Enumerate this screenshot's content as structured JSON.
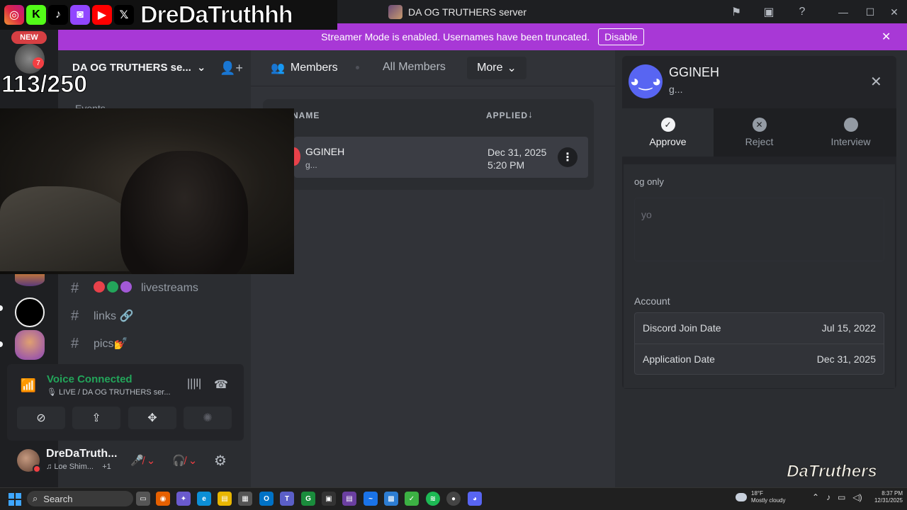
{
  "window": {
    "title": "DA OG TRUTHERS server"
  },
  "titlebar_icons": [
    "flag-icon",
    "inbox-icon",
    "help-icon"
  ],
  "banner": {
    "text": "Streamer Mode is enabled. Usernames have been truncated.",
    "button_label": "Disable"
  },
  "overlay": {
    "handle": "DreDaTruthhh",
    "social_icons": [
      "instagram-icon",
      "kick-icon",
      "tiktok-icon",
      "twitch-icon",
      "youtube-icon",
      "x-icon"
    ],
    "new_badge": "NEW",
    "counter": "113/250",
    "watermark": "DaTruthers"
  },
  "server_rail": {
    "unread_count": "7"
  },
  "sidebar": {
    "server_name": "DA OG TRUTHERS se...",
    "events_label": "Events",
    "channels": [
      {
        "name": "livestreams",
        "prefix_dot_colors": [
          "#e8414a",
          "#23a55a",
          "#a259d6"
        ]
      },
      {
        "name": "links 🔗"
      },
      {
        "name": "pics💅"
      }
    ]
  },
  "voice": {
    "status": "Voice Connected",
    "channel": "LIVE / DA OG TRUTHERS ser..."
  },
  "user": {
    "name": "DreDaTruth...",
    "activity": "Loe Shim...",
    "activity_extra": "+1"
  },
  "members": {
    "tabs": {
      "members": "Members",
      "all": "All Members",
      "more": "More"
    },
    "columns": {
      "name": "NAME",
      "applied": "APPLIED"
    },
    "rows": [
      {
        "name": "GGINEH",
        "tag": "g...",
        "date_line1": "Dec 31, 2025",
        "date_line2": "5:20 PM"
      }
    ]
  },
  "panel": {
    "name": "GGINEH",
    "tag": "g...",
    "actions": {
      "approve": "Approve",
      "reject": "Reject",
      "interview": "Interview"
    },
    "question": "og only",
    "answer": "yo",
    "account_label": "Account",
    "account_rows": [
      {
        "label": "Discord Join Date",
        "value": "Jul 15, 2022"
      },
      {
        "label": "Application Date",
        "value": "Dec 31, 2025"
      }
    ]
  },
  "taskbar": {
    "search_label": "Search",
    "weather_temp": "18°F",
    "weather_desc": "Mostly cloudy",
    "time": "8:37 PM",
    "date": "12/31/2025"
  },
  "colors": {
    "accent": "#5865f2",
    "banner": "#a838d6",
    "voice_green": "#23a55a",
    "danger": "#f23f43"
  }
}
